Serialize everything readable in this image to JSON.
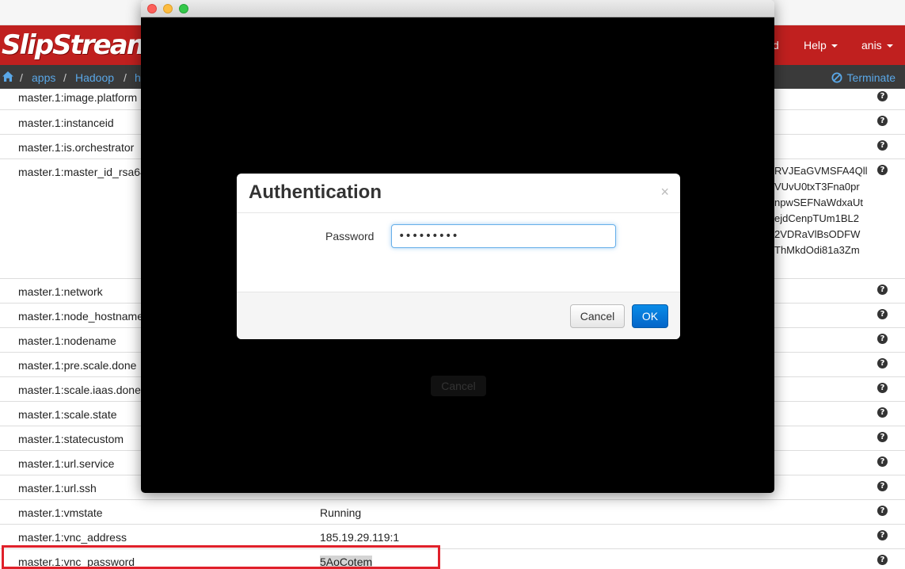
{
  "navbar": {
    "logo": "SlipStream.",
    "partial_item": "d",
    "help_label": "Help",
    "user_label": "anis"
  },
  "breadcrumb": {
    "items": [
      "apps",
      "Hadoop",
      "h"
    ],
    "terminate_label": "Terminate"
  },
  "table": {
    "rows": [
      {
        "key": "master.1:image.platform",
        "value": ""
      },
      {
        "key": "master.1:instanceid",
        "value": ""
      },
      {
        "key": "master.1:is.orchestrator",
        "value": ""
      },
      {
        "key": "master.1:master_id_rsa64",
        "value": ""
      },
      {
        "key": "master.1:network",
        "value": ""
      },
      {
        "key": "master.1:node_hostname",
        "value": ""
      },
      {
        "key": "master.1:nodename",
        "value": ""
      },
      {
        "key": "master.1:pre.scale.done",
        "value": ""
      },
      {
        "key": "master.1:scale.iaas.done",
        "value": ""
      },
      {
        "key": "master.1:scale.state",
        "value": ""
      },
      {
        "key": "master.1:statecustom",
        "value": ""
      },
      {
        "key": "master.1:url.service",
        "value": ""
      },
      {
        "key": "master.1:url.ssh",
        "value": ""
      },
      {
        "key": "master.1:vmstate",
        "value": "Running"
      },
      {
        "key": "master.1:vnc_address",
        "value": "185.19.29.119:1"
      },
      {
        "key": "master.1:vnc_password",
        "value": "5AoCotem"
      }
    ],
    "rsa_fragments": [
      "RVJEaGVMSFA4Qll",
      "VUvU0txT3Fna0pr",
      "npwSEFNaWdxaUt",
      "ejdCenpTUm1BL2",
      "2VDRaVlBsODFW",
      "ThMkdOdi81a3Zm"
    ],
    "help_icon_glyph": "?"
  },
  "vnc_window": {
    "background_cancel_label": "Cancel"
  },
  "dialog": {
    "title": "Authentication",
    "close_glyph": "×",
    "password_label": "Password",
    "password_value": "•••••••••",
    "cancel_label": "Cancel",
    "ok_label": "OK"
  },
  "colors": {
    "brand_red": "#c0201f",
    "link_blue": "#5aa8e8",
    "ok_blue": "#0a7ad8",
    "highlight_red": "#e0202a"
  }
}
